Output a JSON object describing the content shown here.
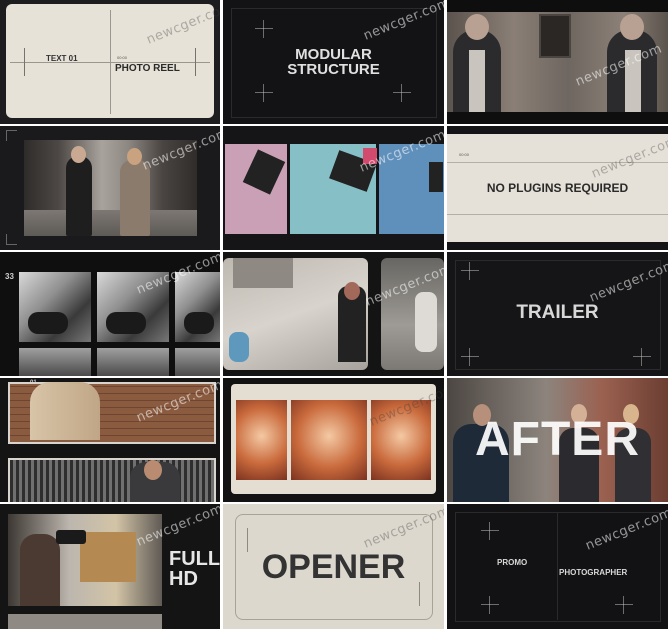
{
  "watermark": "newcger.com",
  "tiles": {
    "photo_reel": {
      "text01": "TEXT 01",
      "title": "PHOTO REEL",
      "tiny": "00:00"
    },
    "modular": {
      "line1": "MODULAR",
      "line2": "STRUCTURE"
    },
    "no_plugins": {
      "title": "NO PLUGINS REQUIRED",
      "tiny": "00:00"
    },
    "filmstrip": {
      "number": "33"
    },
    "trailer": {
      "title": "TRAILER"
    },
    "portrait": {
      "number": "01"
    },
    "after": {
      "title": "AFTER"
    },
    "full_hd": {
      "line1": "FULL",
      "line2": "HD"
    },
    "opener": {
      "title": "OPENER"
    },
    "promo": {
      "label1": "PROMO",
      "label2": "PHOTOGRAPHER"
    }
  }
}
